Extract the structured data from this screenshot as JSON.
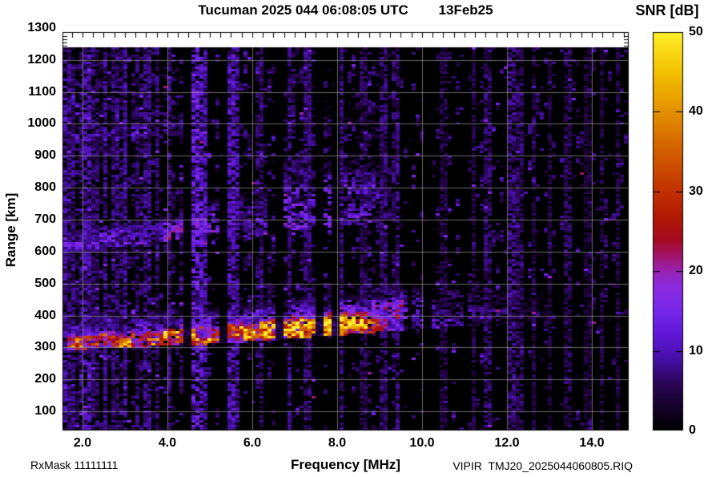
{
  "colors": {
    "page_background": "#ffffff",
    "plot_background": "#000000",
    "no_data_band": "#ffffff",
    "grid": "#8c8c8c",
    "frame": "#000000",
    "text": "#000000"
  },
  "chart_data": {
    "type": "heatmap",
    "title": "Tucuman 2025 044 06:08:05 UTC        13Feb25",
    "station": "Tucuman",
    "timestamp": "2025 044 06:08:05 UTC",
    "date_label": "13Feb25",
    "xlabel": "Frequency [MHz]",
    "ylabel": "Range [km]",
    "xlim": [
      1.53,
      14.87
    ],
    "ylim": [
      40,
      1287
    ],
    "data_top_km": 1240,
    "grid": true,
    "xtick_values": [
      2,
      4,
      6,
      8,
      10,
      12,
      14
    ],
    "xtick_labels": [
      "2.0",
      "4.0",
      "6.0",
      "8.0",
      "10.0",
      "12.0",
      "14.0"
    ],
    "ytick_values": [
      100,
      200,
      300,
      400,
      500,
      600,
      700,
      800,
      900,
      1000,
      1100,
      1200,
      1300
    ],
    "colorbar": {
      "label": "SNR [dB]",
      "min": 0,
      "max": 50,
      "ticks": [
        0,
        10,
        20,
        30,
        40,
        50
      ],
      "stops": [
        [
          0,
          "#000000"
        ],
        [
          3,
          "#140228"
        ],
        [
          6,
          "#2b0658"
        ],
        [
          9,
          "#4510a8"
        ],
        [
          12,
          "#5f17d6"
        ],
        [
          15,
          "#7627ea"
        ],
        [
          18,
          "#8b2be0"
        ],
        [
          20,
          "#9723b4"
        ],
        [
          22,
          "#a11468"
        ],
        [
          24,
          "#a60a1e"
        ],
        [
          27,
          "#b21a02"
        ],
        [
          30,
          "#c13000"
        ],
        [
          35,
          "#d25e00"
        ],
        [
          40,
          "#e39000"
        ],
        [
          45,
          "#f2c000"
        ],
        [
          50,
          "#ffee2a"
        ]
      ]
    },
    "annotations": {
      "rx_mask": "RxMask 11111111",
      "source_file": "VIPIR  TMJ20_2025044060805.RIQ"
    },
    "ionogram": {
      "echo_bottom_km": {
        "f": [
          1.53,
          2,
          3,
          4,
          5,
          6,
          7,
          8,
          9,
          10,
          11,
          12,
          13,
          14,
          14.87
        ],
        "km": [
          291,
          294,
          299,
          304,
          310,
          318,
          327,
          337,
          348,
          358,
          367,
          375,
          383,
          390,
          394
        ]
      },
      "bands": [
        {
          "name": "F-trace bright core",
          "rel": true,
          "fmin": 1.6,
          "fmax": 9.35,
          "off_lo": [
            0,
            0
          ],
          "off_hi": [
            55,
            85
          ],
          "snr": [
            26,
            40
          ],
          "fill": 0.93,
          "fade_hi": 0.3,
          "fade_fmax": 0.1
        },
        {
          "name": "F-trace halo",
          "rel": true,
          "fmin": 1.53,
          "fmax": 9.6,
          "off_lo": [
            0,
            0
          ],
          "off_hi": [
            110,
            155
          ],
          "snr": [
            10,
            16
          ],
          "fill": 0.78,
          "fade_hi": 0.5,
          "fade_fmax": 0
        },
        {
          "name": "spread-F tail",
          "rel": true,
          "fmin": 9.3,
          "fmax": 13.6,
          "off_lo": [
            0,
            0
          ],
          "off_hi": [
            150,
            110
          ],
          "snr": [
            11,
            5
          ],
          "fill": 0.6,
          "fade_hi": 0.5,
          "fade_fmax": 0.45
        },
        {
          "name": "second hop low",
          "rel": false,
          "fmin": 1.53,
          "fmax": 4.45,
          "km_lo": [
            597,
            640
          ],
          "km_hi": [
            668,
            718
          ],
          "snr": [
            11,
            14
          ],
          "fill": 0.82,
          "fade_hi": 0.35,
          "fade_fmax": 0
        },
        {
          "name": "second hop mid",
          "rel": false,
          "fmin": 4.45,
          "fmax": 6.35,
          "km_lo": [
            615,
            645
          ],
          "km_hi": [
            765,
            805
          ],
          "snr": [
            13,
            12
          ],
          "fill": 0.62,
          "fade_hi": 0.5,
          "fade_fmax": 0
        },
        {
          "name": "second hop cloud",
          "rel": false,
          "fmin": 6.7,
          "fmax": 9.6,
          "km_lo": [
            660,
            700
          ],
          "km_hi": [
            905,
            930
          ],
          "snr": [
            12,
            10
          ],
          "fill": 0.55,
          "fade_hi": 0.5,
          "fade_fmax": 0.3
        },
        {
          "name": "third hop",
          "rel": false,
          "fmin": 1.6,
          "fmax": 4.6,
          "km_lo": [
            930,
            965
          ],
          "km_hi": [
            1000,
            1040
          ],
          "snr": [
            8,
            10
          ],
          "fill": 0.6,
          "fade_hi": 0.45,
          "fade_fmax": 0.25
        },
        {
          "name": "high faint cloud",
          "rel": false,
          "fmin": 7.2,
          "fmax": 9.4,
          "km_lo": [
            930,
            950
          ],
          "km_hi": [
            1080,
            1100
          ],
          "snr": [
            6,
            5
          ],
          "fill": 0.42,
          "fade_hi": 0.5,
          "fade_fmax": 0.4
        }
      ],
      "rfi_stripes": [
        [
          1.57,
          0.05,
          11
        ],
        [
          1.66,
          0.04,
          8
        ],
        [
          1.74,
          0.04,
          9
        ],
        [
          2.02,
          0.04,
          9
        ],
        [
          2.13,
          0.05,
          11
        ],
        [
          2.32,
          0.04,
          8
        ],
        [
          2.55,
          0.04,
          9
        ],
        [
          2.76,
          0.04,
          8
        ],
        [
          3.02,
          0.05,
          10
        ],
        [
          3.28,
          0.04,
          8
        ],
        [
          3.52,
          0.04,
          9
        ],
        [
          3.78,
          0.04,
          8
        ],
        [
          4.05,
          0.04,
          9
        ],
        [
          4.63,
          0.1,
          15
        ],
        [
          4.78,
          0.07,
          13
        ],
        [
          4.9,
          0.05,
          11
        ],
        [
          5.52,
          0.08,
          12
        ],
        [
          5.65,
          0.05,
          10
        ],
        [
          6.2,
          0.04,
          8
        ],
        [
          6.9,
          0.05,
          9
        ],
        [
          7.32,
          0.04,
          8
        ],
        [
          7.52,
          0.04,
          9
        ],
        [
          8.12,
          0.05,
          8
        ],
        [
          8.62,
          0.04,
          7
        ],
        [
          9.08,
          0.04,
          8
        ],
        [
          9.45,
          0.05,
          9
        ],
        [
          10.52,
          0.04,
          6
        ],
        [
          11.22,
          0.04,
          6
        ],
        [
          11.55,
          0.04,
          8
        ],
        [
          12.12,
          0.05,
          9
        ],
        [
          12.32,
          0.04,
          7
        ],
        [
          12.62,
          0.04,
          6
        ],
        [
          13.02,
          0.04,
          6
        ],
        [
          13.45,
          0.04,
          7
        ],
        [
          13.92,
          0.04,
          5
        ],
        [
          14.25,
          0.04,
          6
        ],
        [
          14.6,
          0.04,
          6
        ]
      ],
      "dark_gaps": [
        [
          4.5,
          0.1
        ],
        [
          5.33,
          0.06
        ],
        [
          6.62,
          0.06
        ],
        [
          7.6,
          0.09
        ],
        [
          7.97,
          0.06
        ],
        [
          9.7,
          0.05
        ],
        [
          10.15,
          0.07
        ],
        [
          11.05,
          0.05
        ],
        [
          13.2,
          0.05
        ]
      ],
      "noise": {
        "d_low": 0.2,
        "d_mid": 0.13,
        "d_high": 0.065,
        "f_low": 5.0,
        "f_high": 9.5
      }
    }
  }
}
